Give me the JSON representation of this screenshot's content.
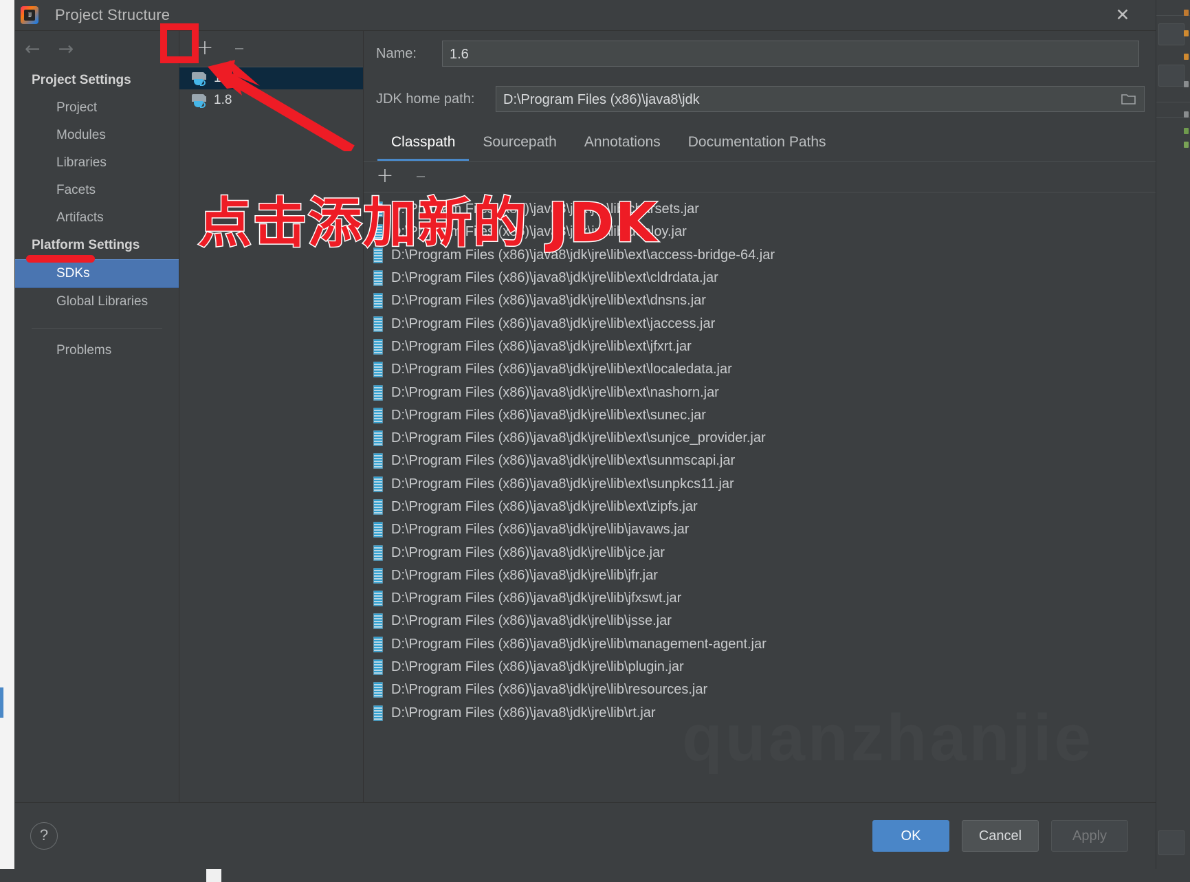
{
  "window": {
    "title": "Project Structure",
    "logo_text": "IJ",
    "close_icon": "✕"
  },
  "nav": {
    "back_icon": "←",
    "forward_icon": "→",
    "groups": [
      {
        "section": "Project Settings",
        "items": [
          "Project",
          "Modules",
          "Libraries",
          "Facets",
          "Artifacts"
        ]
      },
      {
        "section": "Platform Settings",
        "items": [
          "SDKs",
          "Global Libraries"
        ]
      }
    ],
    "selected": "SDKs",
    "problems_label": "Problems"
  },
  "sdk_list": {
    "add_label": "+",
    "remove_label": "–",
    "items": [
      {
        "name": "1.6",
        "selected": true
      },
      {
        "name": "1.8",
        "selected": false
      }
    ]
  },
  "detail": {
    "name_label": "Name:",
    "name_value": "1.6",
    "home_label": "JDK home path:",
    "home_value": "D:\\Program Files (x86)\\java8\\jdk",
    "browse_icon": "folder-icon",
    "tabs": [
      {
        "label": "Classpath",
        "active": true
      },
      {
        "label": "Sourcepath",
        "active": false
      },
      {
        "label": "Annotations",
        "active": false
      },
      {
        "label": "Documentation Paths",
        "active": false
      }
    ],
    "classpath_toolbar": {
      "add_label": "+",
      "remove_label": "–"
    },
    "classpath_entries": [
      "D:\\Program Files (x86)\\java8\\jdk\\jre\\lib\\charsets.jar",
      "D:\\Program Files (x86)\\java8\\jdk\\jre\\lib\\deploy.jar",
      "D:\\Program Files (x86)\\java8\\jdk\\jre\\lib\\ext\\access-bridge-64.jar",
      "D:\\Program Files (x86)\\java8\\jdk\\jre\\lib\\ext\\cldrdata.jar",
      "D:\\Program Files (x86)\\java8\\jdk\\jre\\lib\\ext\\dnsns.jar",
      "D:\\Program Files (x86)\\java8\\jdk\\jre\\lib\\ext\\jaccess.jar",
      "D:\\Program Files (x86)\\java8\\jdk\\jre\\lib\\ext\\jfxrt.jar",
      "D:\\Program Files (x86)\\java8\\jdk\\jre\\lib\\ext\\localedata.jar",
      "D:\\Program Files (x86)\\java8\\jdk\\jre\\lib\\ext\\nashorn.jar",
      "D:\\Program Files (x86)\\java8\\jdk\\jre\\lib\\ext\\sunec.jar",
      "D:\\Program Files (x86)\\java8\\jdk\\jre\\lib\\ext\\sunjce_provider.jar",
      "D:\\Program Files (x86)\\java8\\jdk\\jre\\lib\\ext\\sunmscapi.jar",
      "D:\\Program Files (x86)\\java8\\jdk\\jre\\lib\\ext\\sunpkcs11.jar",
      "D:\\Program Files (x86)\\java8\\jdk\\jre\\lib\\ext\\zipfs.jar",
      "D:\\Program Files (x86)\\java8\\jdk\\jre\\lib\\javaws.jar",
      "D:\\Program Files (x86)\\java8\\jdk\\jre\\lib\\jce.jar",
      "D:\\Program Files (x86)\\java8\\jdk\\jre\\lib\\jfr.jar",
      "D:\\Program Files (x86)\\java8\\jdk\\jre\\lib\\jfxswt.jar",
      "D:\\Program Files (x86)\\java8\\jdk\\jre\\lib\\jsse.jar",
      "D:\\Program Files (x86)\\java8\\jdk\\jre\\lib\\management-agent.jar",
      "D:\\Program Files (x86)\\java8\\jdk\\jre\\lib\\plugin.jar",
      "D:\\Program Files (x86)\\java8\\jdk\\jre\\lib\\resources.jar",
      "D:\\Program Files (x86)\\java8\\jdk\\jre\\lib\\rt.jar"
    ],
    "watermark": "quanzhanjie"
  },
  "footer": {
    "help_label": "?",
    "ok_label": "OK",
    "cancel_label": "Cancel",
    "apply_label": "Apply"
  },
  "annotations": {
    "callout_text": "点击添加新的 JDK",
    "color": "#ee1c25"
  }
}
